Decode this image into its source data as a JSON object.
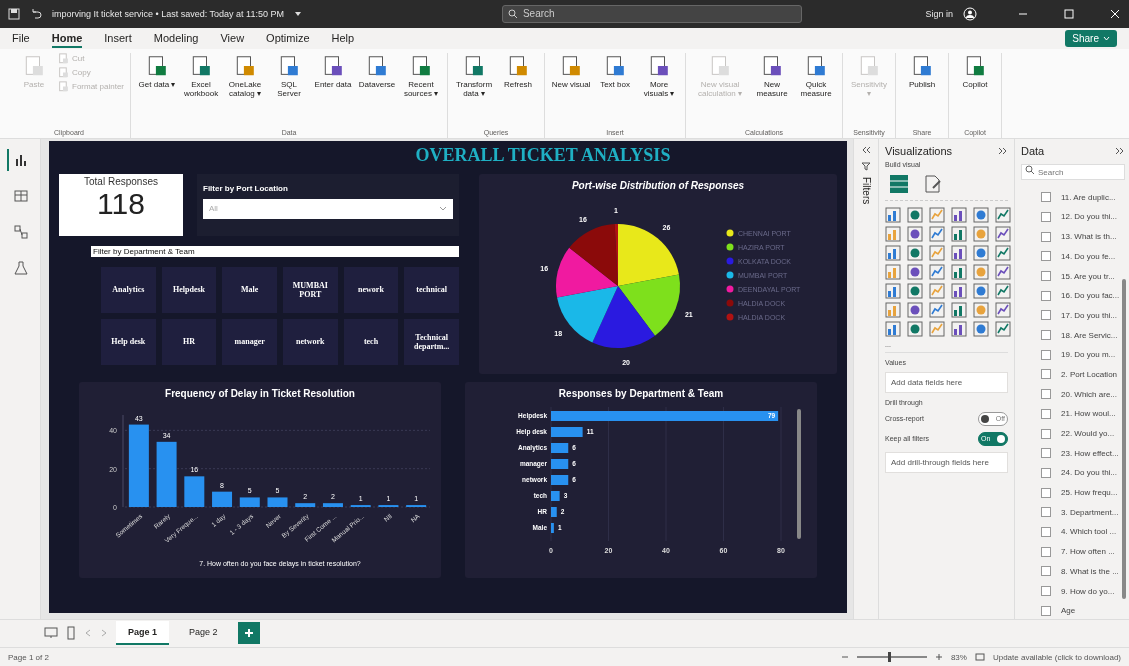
{
  "title_bar": {
    "document": "imporving It ticket service • Last saved: Today at 11:50 PM",
    "search": {
      "placeholder": "Search"
    },
    "sign_in": "Sign in"
  },
  "menu_tabs": [
    {
      "label": "File",
      "selected": false
    },
    {
      "label": "Home",
      "selected": true
    },
    {
      "label": "Insert",
      "selected": false
    },
    {
      "label": "Modeling",
      "selected": false
    },
    {
      "label": "View",
      "selected": false
    },
    {
      "label": "Optimize",
      "selected": false
    },
    {
      "label": "Help",
      "selected": false
    }
  ],
  "share": "Share",
  "ribbon": [
    {
      "group": "Clipboard",
      "buttons": [
        {
          "label": "Paste",
          "kind": "large",
          "disabled": true
        },
        {
          "label": "Cut",
          "kind": "small",
          "disabled": true
        },
        {
          "label": "Copy",
          "kind": "small",
          "disabled": true
        },
        {
          "label": "Format painter",
          "kind": "small",
          "disabled": true
        }
      ]
    },
    {
      "group": "Data",
      "buttons": [
        {
          "label": "Get data ▾",
          "kind": "large",
          "disabled": false
        },
        {
          "label": "Excel workbook",
          "kind": "large",
          "disabled": false
        },
        {
          "label": "OneLake catalog ▾",
          "kind": "large",
          "disabled": false
        },
        {
          "label": "SQL Server",
          "kind": "large",
          "disabled": false
        },
        {
          "label": "Enter data",
          "kind": "large",
          "disabled": false
        },
        {
          "label": "Dataverse",
          "kind": "large",
          "disabled": false
        },
        {
          "label": "Recent sources ▾",
          "kind": "large",
          "disabled": false
        }
      ]
    },
    {
      "group": "Queries",
      "buttons": [
        {
          "label": "Transform data ▾",
          "kind": "large",
          "disabled": false
        },
        {
          "label": "Refresh",
          "kind": "large",
          "disabled": false
        }
      ]
    },
    {
      "group": "Insert",
      "buttons": [
        {
          "label": "New visual",
          "kind": "large",
          "disabled": false
        },
        {
          "label": "Text box",
          "kind": "large",
          "disabled": false
        },
        {
          "label": "More visuals ▾",
          "kind": "large",
          "disabled": false
        }
      ]
    },
    {
      "group": "Calculations",
      "buttons": [
        {
          "label": "New visual calculation ▾",
          "kind": "large",
          "disabled": true
        },
        {
          "label": "New measure",
          "kind": "large",
          "disabled": false
        },
        {
          "label": "Quick measure",
          "kind": "large",
          "disabled": false
        }
      ]
    },
    {
      "group": "Sensitivity",
      "buttons": [
        {
          "label": "Sensitivity ▾",
          "kind": "large",
          "disabled": true
        }
      ]
    },
    {
      "group": "Share",
      "buttons": [
        {
          "label": "Publish",
          "kind": "large",
          "disabled": false
        }
      ]
    },
    {
      "group": "Copilot",
      "buttons": [
        {
          "label": "Copilot",
          "kind": "large",
          "disabled": false
        }
      ]
    }
  ],
  "views": [
    {
      "kind": "report",
      "selected": true
    },
    {
      "kind": "table",
      "selected": false
    },
    {
      "kind": "model",
      "selected": false
    },
    {
      "kind": "dax",
      "selected": false
    }
  ],
  "report": {
    "title": "OVERALL TICKET ANALYSIS",
    "card": {
      "label": "Total Responses",
      "value": "118"
    },
    "port_filter": {
      "title": "Filter by Port Location",
      "value": "All"
    },
    "dept_filter": {
      "title": "Filter by Department & Team",
      "tiles": [
        {
          "label": "Analytics",
          "selected": false
        },
        {
          "label": "Helpdesk",
          "selected": false
        },
        {
          "label": "Male",
          "selected": false
        },
        {
          "label": "MUMBAI PORT",
          "selected": false
        },
        {
          "label": "nework",
          "selected": false
        },
        {
          "label": "technical",
          "selected": false
        },
        {
          "label": "Help desk",
          "selected": false
        },
        {
          "label": "HR",
          "selected": false
        },
        {
          "label": "manager",
          "selected": false
        },
        {
          "label": "network",
          "selected": false
        },
        {
          "label": "tech",
          "selected": false
        },
        {
          "label": "Technical departm...",
          "selected": false
        }
      ]
    },
    "pie": {
      "chart_data": {
        "type": "pie",
        "title": "Port-wise Distribution of Responses",
        "categories": [
          "CHENNAI PORT",
          "HAZIRA PORT",
          "KOLKATA DOCK",
          "MUMBAI PORT",
          "DEENDAYAL PORT",
          "HALDIA DOCK",
          "HALDIA DOCK"
        ],
        "values": [
          26,
          21,
          20,
          18,
          16,
          16,
          1
        ],
        "colors": [
          "#e8e81a",
          "#7ee01c",
          "#2a1ae0",
          "#1ab8e8",
          "#f01aa0",
          "#8b0a0a",
          "#b01212"
        ],
        "legend": true,
        "data_labels": true
      }
    },
    "delay_chart": {
      "chart_data": {
        "type": "bar",
        "title": "Frequency of Delay in Ticket Resolution",
        "xlabel": "7. How often do you face delays in ticket resolution?",
        "categories": [
          "Sometimes",
          "Rarely",
          "Very Freque...",
          "1 day",
          "1 - 3 days",
          "Never",
          "By Severity",
          "First Come ...",
          "Manual Prio...",
          "NIl",
          "NA"
        ],
        "series": [
          {
            "color": "#2891f0",
            "values": [
              43,
              34,
              16,
              8,
              5,
              5,
              2,
              2,
              1,
              1,
              1
            ]
          }
        ],
        "ylim": [
          0,
          48
        ],
        "yticks": [
          0,
          20,
          40
        ],
        "grid": true,
        "data_labels": true
      }
    },
    "dept_chart": {
      "chart_data": {
        "type": "bar",
        "orientation": "horizontal",
        "title": "Responses by Department & Team",
        "categories": [
          "Helpdesk",
          "Help desk",
          "Analytics",
          "manager",
          "network",
          "tech",
          "HR",
          "Male"
        ],
        "series": [
          {
            "color": "#2891f0",
            "values": [
              79,
              11,
              6,
              6,
              6,
              3,
              2,
              1
            ]
          }
        ],
        "xlim": [
          0,
          80
        ],
        "xticks": [
          0,
          20,
          40,
          60,
          80
        ],
        "grid": true,
        "data_labels": true
      }
    }
  },
  "filters_pane": {
    "label": "Filters"
  },
  "visualizations": {
    "title": "Visualizations",
    "build_label": "Build visual",
    "more": "...",
    "values": {
      "title": "Values",
      "hint": "Add data fields here"
    },
    "drill": {
      "title": "Drill through",
      "toggles": [
        {
          "label": "Cross-report",
          "on": false,
          "text": "Off"
        },
        {
          "label": "Keep all filters",
          "on": true,
          "text": "On"
        }
      ],
      "hint": "Add drill-through fields here"
    }
  },
  "data_pane": {
    "title": "Data",
    "search": {
      "placeholder": "Search"
    },
    "fields": [
      {
        "label": "11. Are duplic...",
        "checked": false
      },
      {
        "label": "12. Do you thi...",
        "checked": false
      },
      {
        "label": "13. What is th...",
        "checked": false
      },
      {
        "label": "14. Do you fe...",
        "checked": false
      },
      {
        "label": "15. Are you tr...",
        "checked": false
      },
      {
        "label": "16. Do you fac...",
        "checked": false
      },
      {
        "label": "17. Do you thi...",
        "checked": false
      },
      {
        "label": "18. Are Servic...",
        "checked": false
      },
      {
        "label": "19. Do you m...",
        "checked": false
      },
      {
        "label": "2. Port Location",
        "checked": false
      },
      {
        "label": "20. Which are...",
        "checked": false
      },
      {
        "label": "21. How woul...",
        "checked": false
      },
      {
        "label": "22. Would yo...",
        "checked": false
      },
      {
        "label": "23. How effect...",
        "checked": false
      },
      {
        "label": "24. Do you thi...",
        "checked": false
      },
      {
        "label": "25. How frequ...",
        "checked": false
      },
      {
        "label": "3. Department...",
        "checked": false
      },
      {
        "label": "4. Which tool ...",
        "checked": false
      },
      {
        "label": "7. How often ...",
        "checked": false
      },
      {
        "label": "8. What is the ...",
        "checked": false
      },
      {
        "label": "9. How do yo...",
        "checked": false
      },
      {
        "label": "Age",
        "checked": false
      }
    ]
  },
  "pages": [
    {
      "label": "Page 1",
      "selected": true
    },
    {
      "label": "Page 2",
      "selected": false
    }
  ],
  "status_bar": {
    "page": "Page 1 of 2",
    "zoom": {
      "level": 0.45,
      "reading": "83%"
    },
    "update": "Update available (click to download)"
  }
}
